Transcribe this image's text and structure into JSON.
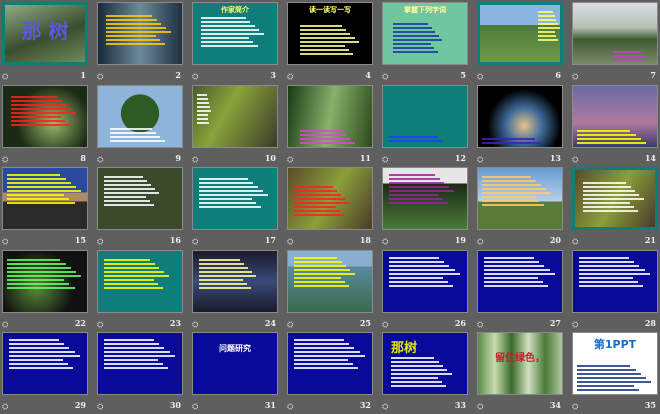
{
  "view": "slide-sorter",
  "slides": [
    {
      "number": "1",
      "title": "那 树",
      "title_color": "#5a5ad8"
    },
    {
      "number": "2",
      "title": ""
    },
    {
      "number": "3",
      "title": "作家简介",
      "title_color": "#ffff66"
    },
    {
      "number": "4",
      "title": "读一读写一写",
      "title_color": "#ffff66"
    },
    {
      "number": "5",
      "title": "掌握下列字词",
      "title_color": "#ffff99"
    },
    {
      "number": "6",
      "title": ""
    },
    {
      "number": "7",
      "title": ""
    },
    {
      "number": "8",
      "title": ""
    },
    {
      "number": "9",
      "title": ""
    },
    {
      "number": "10",
      "title": ""
    },
    {
      "number": "11",
      "title": ""
    },
    {
      "number": "12",
      "title": ""
    },
    {
      "number": "13",
      "title": ""
    },
    {
      "number": "14",
      "title": ""
    },
    {
      "number": "15",
      "title": ""
    },
    {
      "number": "16",
      "title": ""
    },
    {
      "number": "17",
      "title": ""
    },
    {
      "number": "18",
      "title": ""
    },
    {
      "number": "19",
      "title": ""
    },
    {
      "number": "20",
      "title": ""
    },
    {
      "number": "21",
      "title": ""
    },
    {
      "number": "22",
      "title": ""
    },
    {
      "number": "23",
      "title": ""
    },
    {
      "number": "24",
      "title": ""
    },
    {
      "number": "25",
      "title": ""
    },
    {
      "number": "26",
      "title": ""
    },
    {
      "number": "27",
      "title": ""
    },
    {
      "number": "28",
      "title": ""
    },
    {
      "number": "29",
      "title": ""
    },
    {
      "number": "30",
      "title": ""
    },
    {
      "number": "31",
      "title": "问题研究",
      "title_color": "#ffffff"
    },
    {
      "number": "32",
      "title": ""
    },
    {
      "number": "33",
      "title": "那树",
      "title_color": "#e6e600"
    },
    {
      "number": "34",
      "title": "留住绿色，",
      "title_color": "#c0202a"
    },
    {
      "number": "35",
      "title": "第1PPT",
      "title_color": "#1a6ad0"
    }
  ],
  "animation_icon": "slide-transition-icon"
}
